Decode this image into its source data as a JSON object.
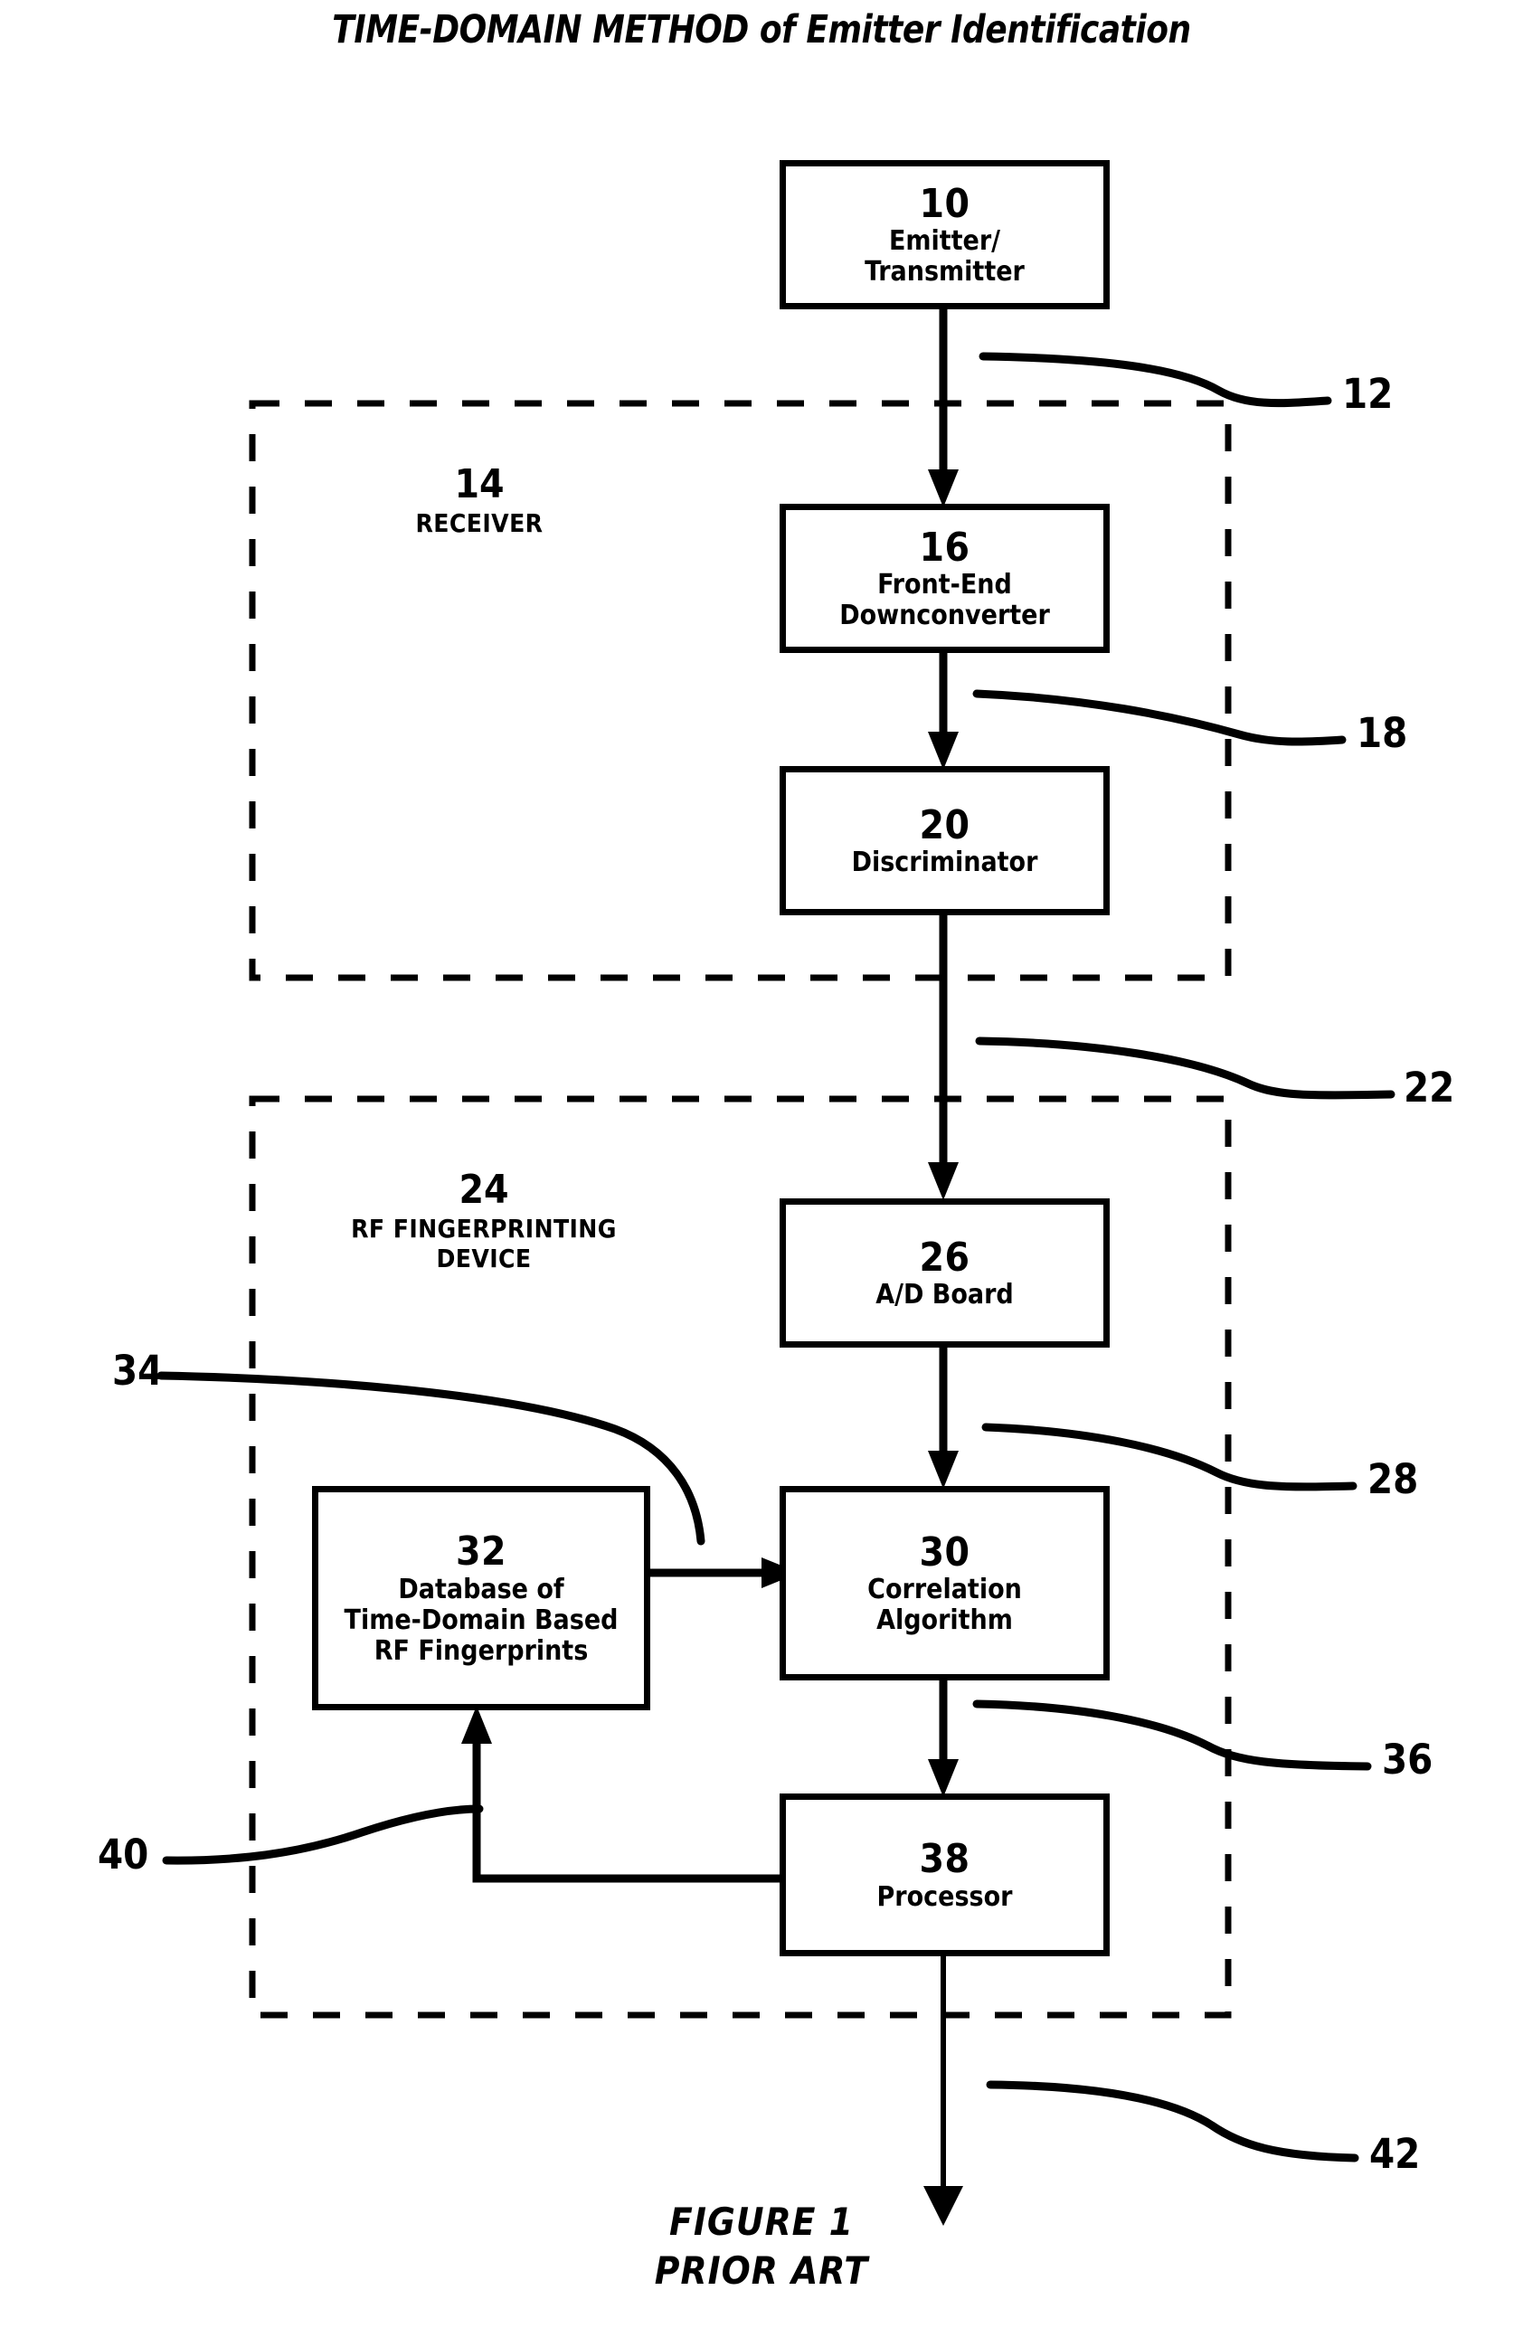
{
  "title": "TIME-DOMAIN METHOD of Emitter Identification",
  "figure_caption": {
    "line1": "FIGURE 1",
    "line2": "PRIOR ART"
  },
  "boxes": [
    {
      "id": "emitter",
      "number": "10",
      "line1": "Emitter/",
      "line2": "Transmitter",
      "line3": ""
    },
    {
      "id": "downconverter",
      "number": "16",
      "line1": "Front-End",
      "line2": "Downconverter",
      "line3": ""
    },
    {
      "id": "discriminator",
      "number": "20",
      "line1": "Discriminator",
      "line2": "",
      "line3": ""
    },
    {
      "id": "ad-board",
      "number": "26",
      "line1": "A/D Board",
      "line2": "",
      "line3": ""
    },
    {
      "id": "database",
      "number": "32",
      "line1": "Database of",
      "line2": "Time-Domain Based",
      "line3": "RF Fingerprints"
    },
    {
      "id": "correlation",
      "number": "30",
      "line1": "Correlation",
      "line2": "Algorithm",
      "line3": ""
    },
    {
      "id": "processor",
      "number": "38",
      "line1": "Processor",
      "line2": "",
      "line3": ""
    }
  ],
  "groups": [
    {
      "id": "receiver",
      "number": "14",
      "label_line1": "RECEIVER",
      "label_line2": ""
    },
    {
      "id": "rf-fingerprint",
      "number": "24",
      "label_line1": "RF FINGERPRINTING",
      "label_line2": "DEVICE"
    }
  ],
  "reference_labels": [
    {
      "id": "ref-12",
      "text": "12"
    },
    {
      "id": "ref-18",
      "text": "18"
    },
    {
      "id": "ref-22",
      "text": "22"
    },
    {
      "id": "ref-28",
      "text": "28"
    },
    {
      "id": "ref-34",
      "text": "34"
    },
    {
      "id": "ref-36",
      "text": "36"
    },
    {
      "id": "ref-40",
      "text": "40"
    },
    {
      "id": "ref-42",
      "text": "42"
    }
  ],
  "colors": {
    "ink": "#000000",
    "paper": "#ffffff"
  }
}
